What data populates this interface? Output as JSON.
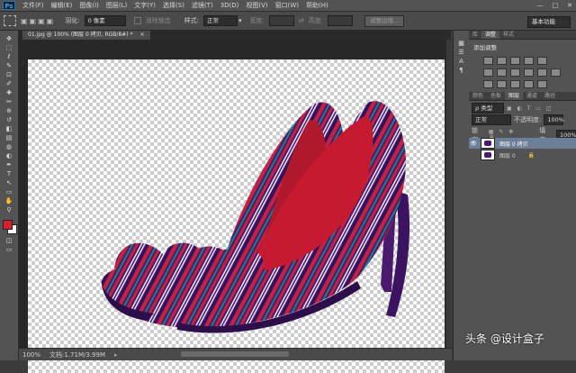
{
  "app": {
    "logo": "Ps"
  },
  "menu": [
    "文件(F)",
    "编辑(E)",
    "图像(I)",
    "图层(L)",
    "文字(Y)",
    "选择(S)",
    "滤镜(T)",
    "3D(D)",
    "视图(V)",
    "窗口(W)",
    "帮助(H)"
  ],
  "window_controls": [
    "—",
    "□",
    "✕"
  ],
  "options_bar": {
    "feather_label": "羽化:",
    "feather_value": "0 像素",
    "antialias_label": "消除锯齿",
    "style_label": "样式:",
    "style_value": "正常",
    "width_label": "宽度:",
    "height_label": "高度:",
    "refine_edge_button": "调整边缘...",
    "workspace": "基本功能"
  },
  "document": {
    "tab_label": "01.jpg @ 100% (图层 0 拷贝, RGB/8#) *",
    "close": "×"
  },
  "status_bar": {
    "zoom": "100%",
    "doc_info": "文档:1.71M/3.99M"
  },
  "panels": {
    "top_tabs": [
      "库",
      "调整",
      "样式"
    ],
    "adjust_title": "添加调整",
    "layer_tabs": [
      "颜色",
      "色板",
      "图层",
      "通道",
      "路径"
    ],
    "filter_label": "ρ 类型",
    "blend_mode": "正常",
    "opacity_label": "不透明度:",
    "opacity_value": "100%",
    "lock_label": "锁定:",
    "fill_label": "填充:",
    "fill_value": "100%",
    "layers": [
      {
        "name": "图层 0 拷贝",
        "selected": true,
        "visible": true
      },
      {
        "name": "图层 0",
        "selected": false,
        "visible": false
      }
    ]
  },
  "icons": {
    "tools": [
      "move-icon",
      "marquee-icon",
      "lasso-icon",
      "quick-select-icon",
      "crop-icon",
      "eyedropper-icon",
      "healing-icon",
      "brush-icon",
      "stamp-icon",
      "history-brush-icon",
      "eraser-icon",
      "gradient-icon",
      "blur-icon",
      "dodge-icon",
      "pen-icon",
      "type-icon",
      "path-select-icon",
      "shape-icon",
      "hand-icon",
      "zoom-icon"
    ],
    "tool_glyphs": [
      "✥",
      "⬚",
      "ℓ",
      "✎",
      "⊡",
      "✐",
      "✚",
      "✏",
      "⊕",
      "↺",
      "◧",
      "▤",
      "◍",
      "◐",
      "✒",
      "T",
      "↖",
      "▭",
      "✋",
      "⚲"
    ]
  },
  "colors": {
    "foreground": "#d81f2c",
    "background": "#ffffff",
    "layer_selected": "#6d7f96",
    "shoe_purple": "#4a1a6e",
    "shoe_red": "#c8213f"
  },
  "watermark": "头条 @设计盒子"
}
